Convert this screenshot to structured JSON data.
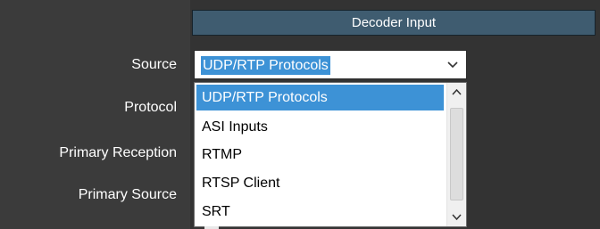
{
  "section": {
    "title": "Decoder Input"
  },
  "form": {
    "labels": {
      "source": "Source",
      "protocol": "Protocol",
      "primary_reception": "Primary Reception",
      "primary_source": "Primary Source"
    },
    "source_select": {
      "value": "UDP/RTP Protocols",
      "options": [
        "UDP/RTP Protocols",
        "ASI Inputs",
        "RTMP",
        "RTSP Client",
        "SRT"
      ],
      "highlighted_index": 0
    }
  },
  "icons": {
    "dropdown_arrow": "chevron-down-icon",
    "scroll_up": "chevron-up-icon",
    "scroll_down": "chevron-down-icon"
  },
  "colors": {
    "selection": "#3d92d6",
    "header_background": "#3f5c70",
    "page_background": "#333333"
  }
}
